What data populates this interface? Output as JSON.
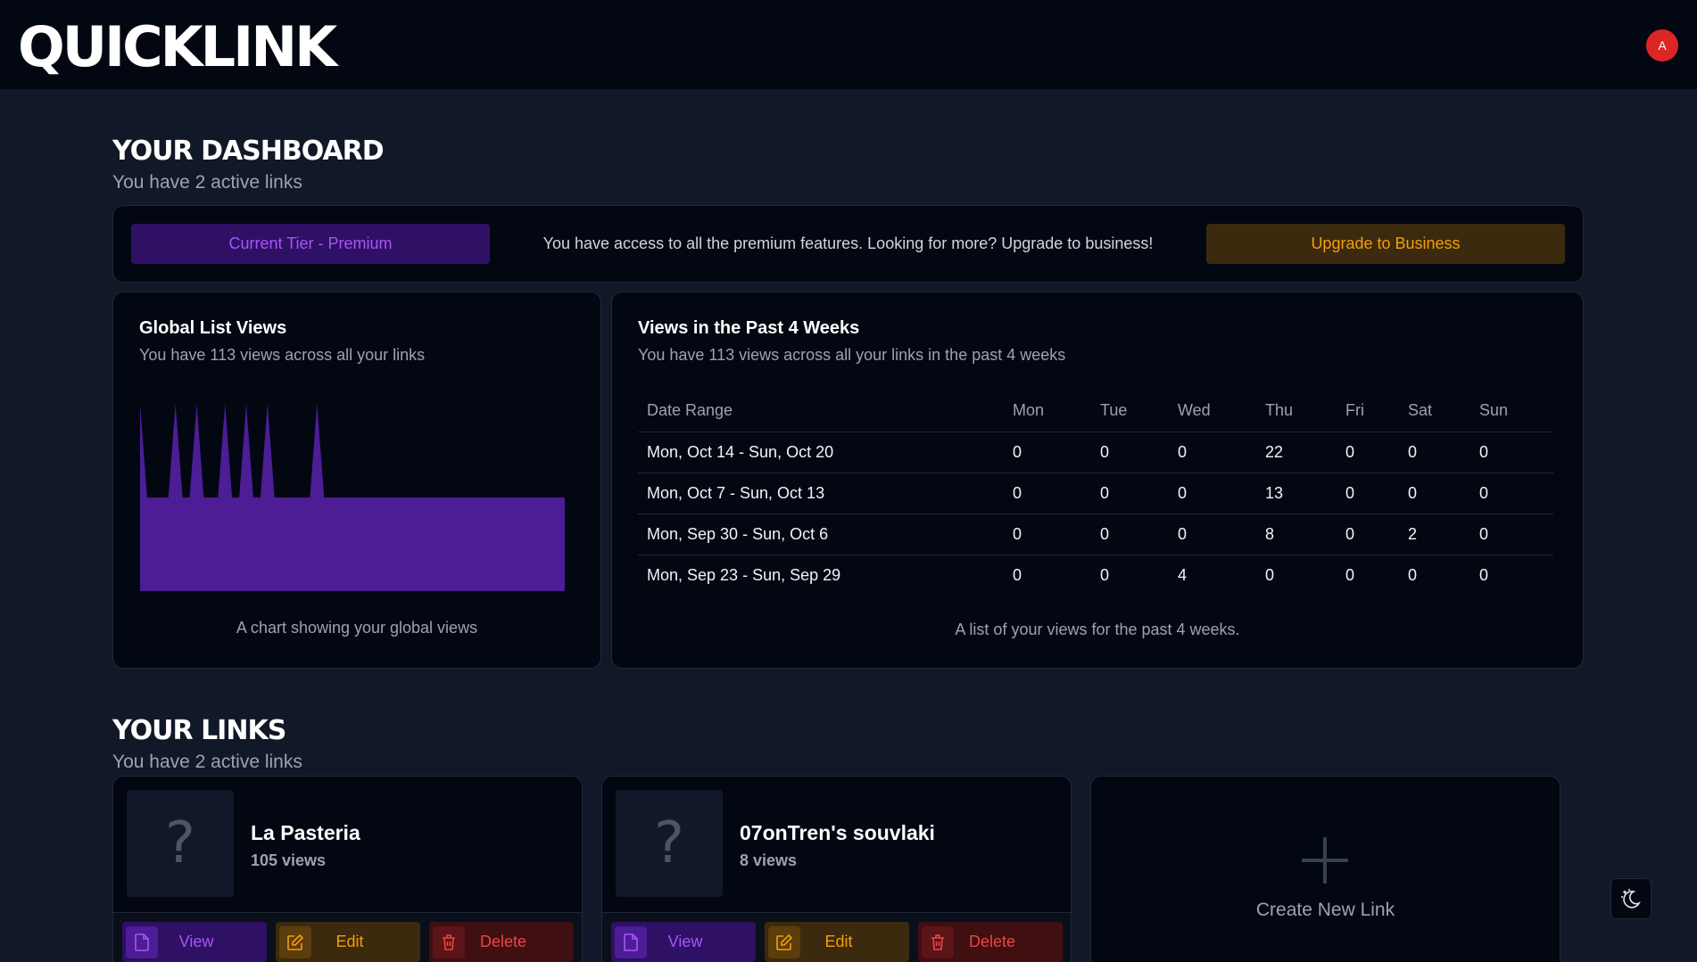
{
  "header": {
    "logo": "QUICKLINK",
    "avatar_initial": "A"
  },
  "dashboard": {
    "title": "YOUR DASHBOARD",
    "subtitle": "You have 2 active links",
    "tier": {
      "badge_label": "Current Tier -  Premium",
      "message": "You have access to all the premium features. Looking for more? Upgrade to business!",
      "upgrade_label": "Upgrade to Business"
    },
    "global_views": {
      "title": "Global List Views",
      "subtitle": "You have 113 views across all your links",
      "caption": "A chart showing your global views"
    },
    "weekly_views": {
      "title": "Views in the Past 4 Weeks",
      "subtitle": "You have 113 views across all your links in the past 4 weeks",
      "caption": "A list of your views for the past 4 weeks.",
      "columns": [
        "Date Range",
        "Mon",
        "Tue",
        "Wed",
        "Thu",
        "Fri",
        "Sat",
        "Sun"
      ],
      "rows": [
        [
          "Mon, Oct 14 - Sun, Oct 20",
          "0",
          "0",
          "0",
          "22",
          "0",
          "0",
          "0"
        ],
        [
          "Mon, Oct 7 - Sun, Oct 13",
          "0",
          "0",
          "0",
          "13",
          "0",
          "0",
          "0"
        ],
        [
          "Mon, Sep 30 - Sun, Oct 6",
          "0",
          "0",
          "0",
          "8",
          "0",
          "2",
          "0"
        ],
        [
          "Mon, Sep 23 - Sun, Sep 29",
          "0",
          "0",
          "4",
          "0",
          "0",
          "0",
          "0"
        ]
      ]
    }
  },
  "chart_data": {
    "type": "area",
    "color": "#4c1d95",
    "x": [
      0,
      1,
      2,
      3,
      4,
      5,
      6,
      7,
      8,
      9,
      10,
      11,
      12,
      13,
      14,
      15,
      16,
      17,
      18,
      19,
      20,
      21,
      22,
      23,
      24,
      25,
      26,
      27,
      28,
      29,
      30,
      31,
      32,
      33,
      34,
      35,
      36,
      37,
      38,
      39,
      40,
      41,
      42,
      43,
      44,
      45,
      46,
      47,
      48,
      49,
      50,
      51,
      52,
      53,
      54,
      55,
      56,
      57,
      58,
      59,
      60
    ],
    "values": [
      2,
      1,
      1,
      1,
      1,
      2,
      1,
      1,
      2,
      1,
      1,
      1,
      2,
      1,
      1,
      2,
      1,
      1,
      2,
      1,
      1,
      1,
      1,
      1,
      1,
      2,
      1,
      1,
      1,
      1,
      1,
      1,
      1,
      1,
      1,
      1,
      1,
      1,
      1,
      1,
      1,
      1,
      1,
      1,
      1,
      1,
      1,
      1,
      1,
      1,
      1,
      1,
      1,
      1,
      1,
      1,
      1,
      1,
      1,
      1,
      1
    ]
  },
  "links": {
    "title": "YOUR LINKS",
    "subtitle": "You have 2 active links",
    "items": [
      {
        "name": "La Pasteria",
        "views": "105 views"
      },
      {
        "name": "07onTren's souvlaki",
        "views": "8 views"
      }
    ],
    "actions": {
      "view": "View",
      "edit": "Edit",
      "delete": "Delete"
    },
    "placeholder_glyph": "?",
    "create_label": "Create New Link"
  }
}
